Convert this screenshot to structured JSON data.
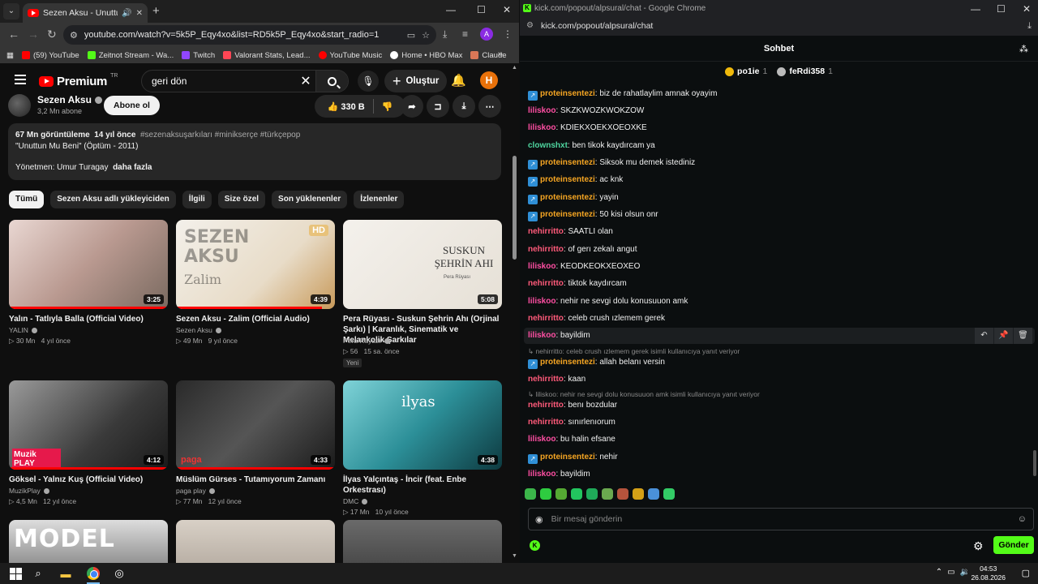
{
  "left_browser": {
    "tab_title": "Sezen Aksu - Unuttun Mu B",
    "url": "youtube.com/watch?v=5k5P_Eqy4xo&list=RD5k5P_Eqy4xo&start_radio=1",
    "bookmarks": [
      {
        "label": "(59) YouTube",
        "color": "#ff0000"
      },
      {
        "label": "Zeitnot Stream - Wa...",
        "color": "#53fc18"
      },
      {
        "label": "Twitch",
        "color": "#9146ff"
      },
      {
        "label": "Valorant Stats, Lead...",
        "color": "#ff4655"
      },
      {
        "label": "YouTube Music",
        "color": "#ff0000"
      },
      {
        "label": "Home • HBO Max",
        "color": "#ffffff"
      },
      {
        "label": "Claude",
        "color": "#d97757"
      }
    ]
  },
  "youtube": {
    "logo_text": "Premium",
    "logo_sup": "TR",
    "search_value": "geri dön",
    "create_label": "Oluştur",
    "avatar_letter": "H",
    "channel": {
      "name": "Sezen Aksu",
      "subs": "3,2 Mn abone",
      "subscribe_label": "Abone ol"
    },
    "likes": "330 B",
    "description": {
      "views": "67 Mn görüntüleme",
      "age": "14 yıl önce",
      "tags": "#sezenaksuşarkıları #minikserçe #türkçepop",
      "line2": "\"Unuttun Mu Beni\" (Öptüm - 2011)",
      "line3": "Yönetmen: Umur Turagay",
      "more": "daha fazla"
    },
    "chips": [
      "Tümü",
      "Sezen Aksu adlı yükleyiciden",
      "İlgili",
      "Size özel",
      "Son yüklenenler",
      "İzlenenler"
    ],
    "videos": [
      {
        "title": "Yalın - Tatlıyla Balla (Official Video)",
        "channel": "YALIN",
        "views": "30 Mn",
        "age": "4 yıl önce",
        "duration": "3:25",
        "thumb": "linear-gradient(135deg,#e9d7d2,#b99990 50%,#7a6a60)",
        "progress": 1.0
      },
      {
        "title": "Sezen Aksu - Zalim (Official Audio)",
        "channel": "Sezen Aksu",
        "views": "49 Mn",
        "age": "9 yıl önce",
        "duration": "4:39",
        "thumb": "linear-gradient(135deg,#f3f0ea,#e8dcc8 60%,#c89a5a)",
        "thumb_text": "SEZEN AKSU",
        "thumb_sub": "Zalim",
        "hd": "HD",
        "progress": 0.92
      },
      {
        "title": "Pera Rüyası - Suskun Şehrin Ahı (Orjinal Şarkı) | Karanlık, Sinematik ve Melankolik Şarkılar",
        "channel": "Pera Rüyası",
        "views": "56",
        "age": "15 sa. önce",
        "duration": "5:08",
        "badge": "Yeni",
        "thumb": "linear-gradient(135deg,#f4f1ec,#e6e0d6)",
        "thumb_text": "SUSKUN ŞEHRİN AHI",
        "thumb_sub": "Pera Rüyası"
      },
      {
        "title": "Göksel - Yalnız Kuş (Official Video)",
        "channel": "MuzikPlay",
        "views": "4,5 Mn",
        "age": "12 yıl önce",
        "duration": "4:12",
        "thumb": "linear-gradient(135deg,#9a9a9a,#3a3a3a 60%,#1a1a1a)",
        "thumb_text": "Muzik PLAY",
        "progress": 1.0
      },
      {
        "title": "Müslüm Gürses - Tutamıyorum Zamanı",
        "channel": "paga play",
        "views": "77 Mn",
        "age": "12 yıl önce",
        "duration": "4:33",
        "thumb": "linear-gradient(135deg,#2a2a2a,#555 50%,#1a1a1a)",
        "thumb_text": "paga",
        "progress": 1.0
      },
      {
        "title": "İlyas Yalçıntaş - İncir (feat. Enbe Orkestrası)",
        "channel": "DMC",
        "views": "17 Mn",
        "age": "10 yıl önce",
        "duration": "4:38",
        "thumb": "linear-gradient(135deg,#7fd3d8,#2c8f98 50%,#0d3a40)",
        "thumb_text": "ilyas"
      },
      {
        "title": "",
        "thumb": "linear-gradient(180deg,#ddd,#444)",
        "thumb_text": "MODEL"
      },
      {
        "title": "",
        "thumb": "linear-gradient(180deg,#d8d0c6,#9a8f84)"
      },
      {
        "title": "",
        "thumb": "linear-gradient(180deg,#6a6a6a,#2a2a2a)"
      }
    ]
  },
  "kick": {
    "window_title": "kick.com/popout/alpsural/chat - Google Chrome",
    "url": "kick.com/popout/alpsural/chat",
    "header": "Sohbet",
    "pinned": [
      {
        "user": "po1ie",
        "count": "1",
        "color": "#f0b90b"
      },
      {
        "user": "feRdi358",
        "count": "1",
        "color": "#bbbbbb"
      }
    ],
    "messages": [
      {
        "user": "proteinsentezi",
        "color": "#f6a623",
        "badge": true,
        "text": "biz de rahatlaylim amnak oyayim"
      },
      {
        "user": "liliskoo",
        "color": "#ff4fa3",
        "text": "SKZKWOZKWOKZOW"
      },
      {
        "user": "liliskoo",
        "color": "#ff4fa3",
        "text": "KDIEKXOEKXOEOXKE"
      },
      {
        "user": "clownshxt",
        "color": "#4fd6a0",
        "text": "ben tikok kaydırcam ya"
      },
      {
        "user": "proteinsentezi",
        "color": "#f6a623",
        "badge": true,
        "text": "Siksok mu demek istediniz"
      },
      {
        "user": "proteinsentezi",
        "color": "#f6a623",
        "badge": true,
        "text": "ac knk"
      },
      {
        "user": "proteinsentezi",
        "color": "#f6a623",
        "badge": true,
        "text": "yayin"
      },
      {
        "user": "proteinsentezi",
        "color": "#f6a623",
        "badge": true,
        "text": "50 kisi olsun onr"
      },
      {
        "user": "nehirritto",
        "color": "#ff5a7a",
        "text": "SAATLI olan"
      },
      {
        "user": "nehirritto",
        "color": "#ff5a7a",
        "text": "of gerı zekalı angut"
      },
      {
        "user": "liliskoo",
        "color": "#ff4fa3",
        "text": "KEODKEOKXEOXEO"
      },
      {
        "user": "nehirritto",
        "color": "#ff5a7a",
        "text": "tiktok kaydırcam"
      },
      {
        "user": "liliskoo",
        "color": "#ff4fa3",
        "text": "nehir ne sevgi dolu konusuuon amk"
      },
      {
        "user": "nehirritto",
        "color": "#ff5a7a",
        "text": "celeb crush ızlemem gerek"
      },
      {
        "user": "liliskoo",
        "color": "#ff4fa3",
        "text": "bayildim",
        "highlight": true
      },
      {
        "reply": "nehirritto: celeb crush ızlemem gerek isimli kullanıcıya yanıt veriyor"
      },
      {
        "user": "proteinsentezi",
        "color": "#f6a623",
        "badge": true,
        "text": "allah belanı versin"
      },
      {
        "user": "nehirritto",
        "color": "#ff5a7a",
        "text": "kaan"
      },
      {
        "reply": "liliskoo: nehir ne sevgi dolu konusuuon amk isimli kullanıcıya yanıt veriyor"
      },
      {
        "user": "nehirritto",
        "color": "#ff5a7a",
        "text": "benı bozdular"
      },
      {
        "user": "nehirritto",
        "color": "#ff5a7a",
        "text": "sınırlenıorum"
      },
      {
        "user": "liliskoo",
        "color": "#ff4fa3",
        "text": "bu halin efsane"
      },
      {
        "user": "proteinsentezi",
        "color": "#f6a623",
        "badge": true,
        "text": "nehir"
      },
      {
        "user": "liliskoo",
        "color": "#ff4fa3",
        "text": "bayildim"
      }
    ],
    "emote_colors": [
      "#3bb54a",
      "#2ecc40",
      "#55aa33",
      "#22c55e",
      "#1faa59",
      "#6aa84f",
      "#b5533c",
      "#d4a017",
      "#4a90d9",
      "#33cc66"
    ],
    "input_placeholder": "Bir mesaj gönderin",
    "send_label": "Gönder"
  },
  "taskbar": {
    "time": "04:53",
    "date": "26.08.2026"
  }
}
